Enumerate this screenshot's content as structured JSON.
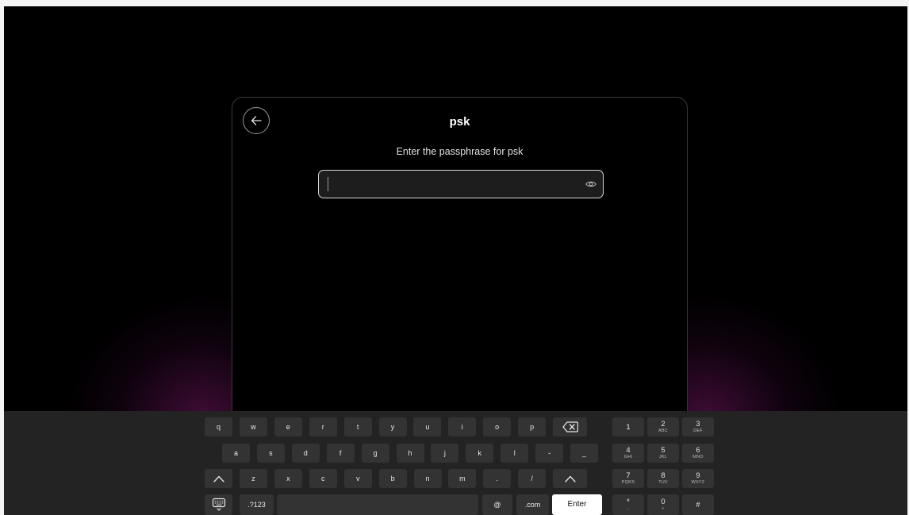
{
  "dialog": {
    "title": "psk",
    "subtitle": "Enter the passphrase for psk",
    "passphrase": {
      "value": "",
      "placeholder": ""
    }
  },
  "keyboard": {
    "rows": [
      [
        "q",
        "w",
        "e",
        "r",
        "t",
        "y",
        "u",
        "i",
        "o",
        "p"
      ],
      [
        "a",
        "s",
        "d",
        "f",
        "g",
        "h",
        "j",
        "k",
        "l",
        "-",
        "_"
      ],
      [
        "z",
        "x",
        "c",
        "v",
        "b",
        "n",
        "m",
        ".",
        "/"
      ]
    ],
    "symbols_label": ".?123",
    "at_label": "@",
    "dotcom_label": ".com",
    "enter_label": "Enter",
    "numpad": [
      {
        "main": "1",
        "sub": ""
      },
      {
        "main": "2",
        "sub": "ABC"
      },
      {
        "main": "3",
        "sub": "DEF"
      },
      {
        "main": "4",
        "sub": "GHI"
      },
      {
        "main": "5",
        "sub": "JKL"
      },
      {
        "main": "6",
        "sub": "MNO"
      },
      {
        "main": "7",
        "sub": "PQRS"
      },
      {
        "main": "8",
        "sub": "TUV"
      },
      {
        "main": "9",
        "sub": "WXYZ"
      },
      {
        "main": "*",
        "sub": ","
      },
      {
        "main": "0",
        "sub": "+"
      },
      {
        "main": "#",
        "sub": ""
      }
    ],
    "icons": {
      "backspace": "backspace-icon",
      "shift": "shift-icon",
      "hide_keyboard": "keyboard-hide-icon"
    }
  },
  "colors": {
    "background": "#000000",
    "keyboard_bg": "#232323",
    "key_bg": "#333333",
    "enter_bg": "#ffffff",
    "glow": "#731662"
  }
}
